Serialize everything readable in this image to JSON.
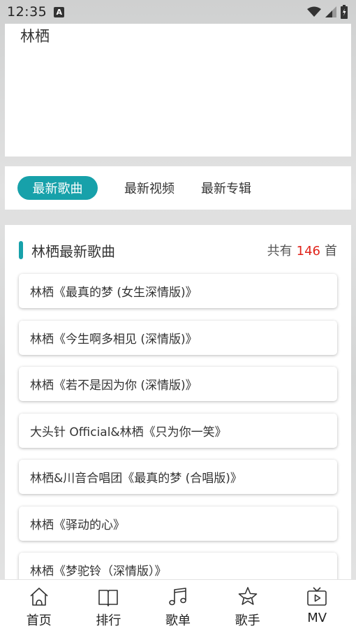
{
  "status_bar": {
    "time": "12:35",
    "notif_letter": "A"
  },
  "artist": {
    "name": "林栖"
  },
  "tabs": [
    {
      "label": "最新歌曲",
      "active": true
    },
    {
      "label": "最新视频",
      "active": false
    },
    {
      "label": "最新专辑",
      "active": false
    }
  ],
  "list": {
    "title": "林栖最新歌曲",
    "count_prefix": "共有",
    "count": "146",
    "count_suffix": "首",
    "songs": [
      "林栖《最真的梦 (女生深情版)》",
      "林栖《今生啊多相见 (深情版)》",
      "林栖《若不是因为你 (深情版)》",
      "大头针 Official&林栖《只为你一笑》",
      "林栖&川音合唱团《最真的梦 (合唱版)》",
      "林栖《驿动的心》",
      "林栖《梦驼铃（深情版）》"
    ]
  },
  "bottom_nav": [
    {
      "label": "首页",
      "icon": "home-icon"
    },
    {
      "label": "排行",
      "icon": "book-icon"
    },
    {
      "label": "歌单",
      "icon": "music-note-icon"
    },
    {
      "label": "歌手",
      "icon": "star-icon"
    },
    {
      "label": "MV",
      "icon": "tv-icon"
    }
  ],
  "colors": {
    "accent": "#17a1aa",
    "count_red": "#e0241b"
  }
}
